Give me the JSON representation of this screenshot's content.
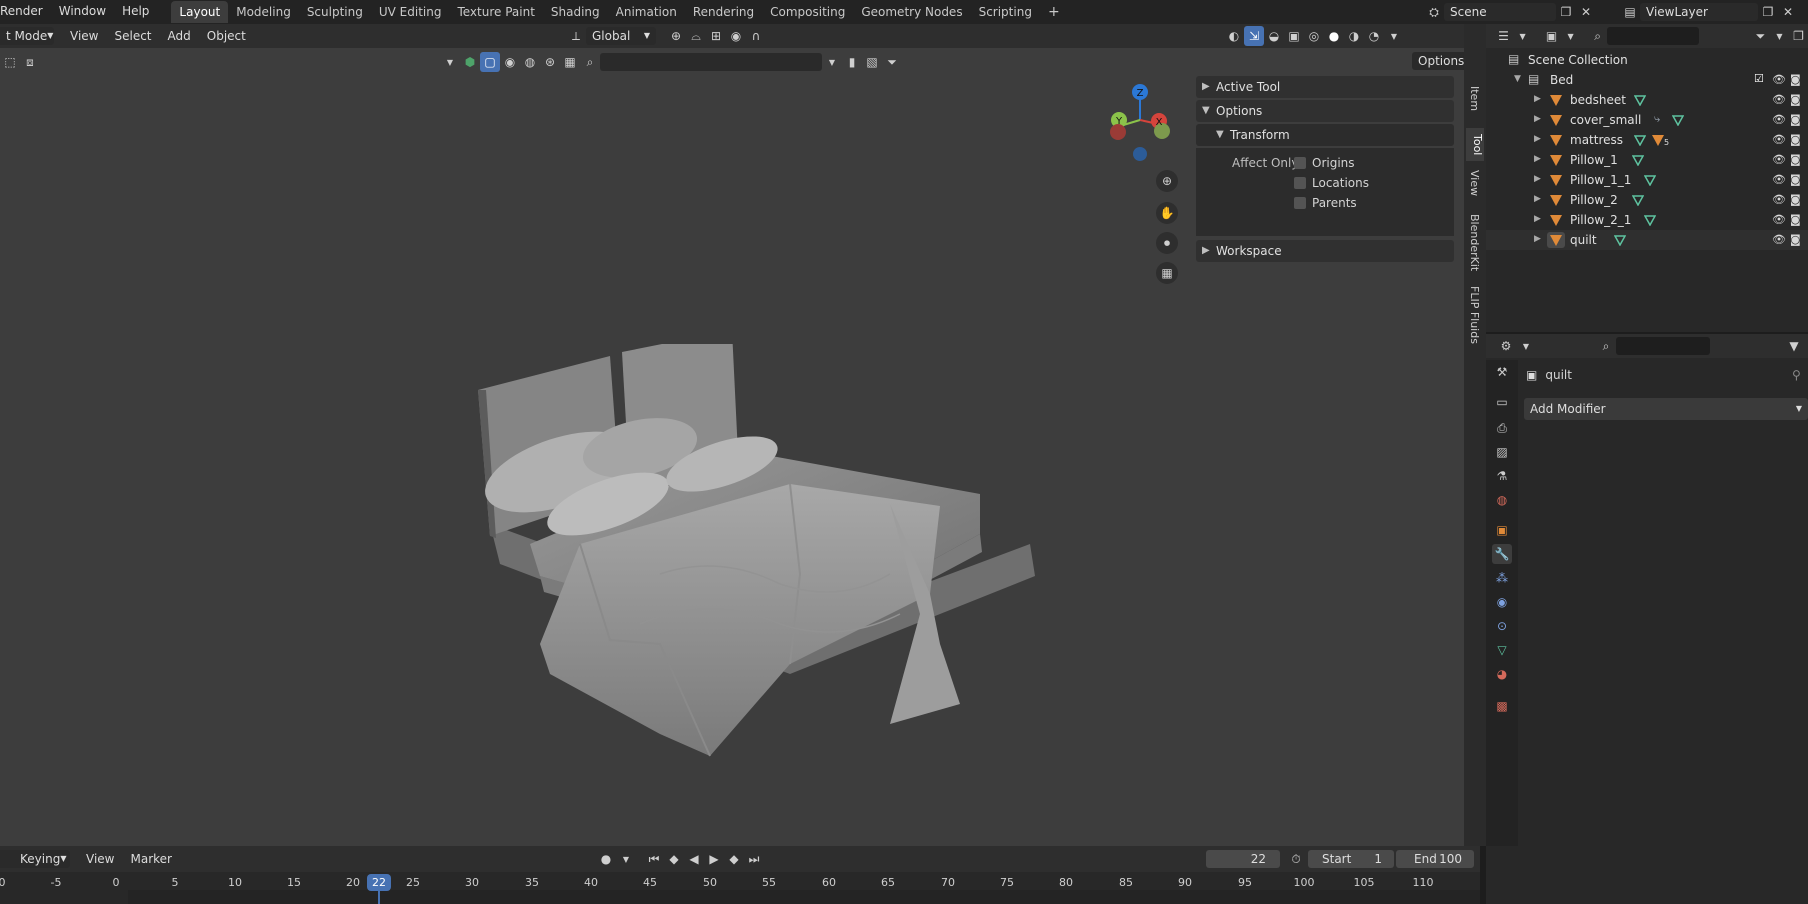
{
  "topbar": {
    "menus": [
      "Render",
      "Window",
      "Help"
    ],
    "workspaces": [
      "Layout",
      "Modeling",
      "Sculpting",
      "UV Editing",
      "Texture Paint",
      "Shading",
      "Animation",
      "Rendering",
      "Compositing",
      "Geometry Nodes",
      "Scripting"
    ],
    "active_workspace": "Layout",
    "add_tab": "+",
    "scene": "Scene",
    "view_layer": "ViewLayer"
  },
  "viewport": {
    "mode": "t Mode",
    "menus": [
      "View",
      "Select",
      "Add",
      "Object"
    ],
    "transform_orientation": "Global",
    "options_label": "Options",
    "npanel": {
      "active_tool": "Active Tool",
      "options": "Options",
      "transform": "Transform",
      "affect_only": "Affect Only",
      "origins": "Origins",
      "locations": "Locations",
      "parents": "Parents",
      "workspace": "Workspace"
    },
    "side_tabs": [
      "Item",
      "Tool",
      "View",
      "BlenderKit",
      "FLIP Fluids"
    ],
    "gizmo": {
      "z": "Z",
      "y": "Y",
      "x": "X"
    }
  },
  "outliner": {
    "scene_collection": "Scene Collection",
    "collection": "Bed",
    "objects": [
      "bedsheet",
      "cover_small",
      "mattress",
      "Pillow_1",
      "Pillow_1_1",
      "Pillow_2",
      "Pillow_2_1",
      "quilt"
    ],
    "mattress_modifier_count": "5"
  },
  "properties": {
    "object_name": "quilt",
    "add_modifier": "Add Modifier"
  },
  "timeline": {
    "menus": [
      "Keying",
      "View",
      "Marker"
    ],
    "current_frame": "22",
    "start_label": "Start",
    "start": "1",
    "end_label": "End",
    "end": "100",
    "ticks": [
      "0",
      "-5",
      "0",
      "5",
      "10",
      "15",
      "20",
      "22",
      "25",
      "30",
      "35",
      "40",
      "45",
      "50",
      "55",
      "60",
      "65",
      "70",
      "75",
      "80",
      "85",
      "90",
      "95",
      "100",
      "105",
      "110"
    ]
  },
  "colors": {
    "accent": "#4772b3",
    "mesh_orange": "#e08a38",
    "mesh_green": "#5ec3a0",
    "viewport_bg": "#3d3d3d"
  }
}
